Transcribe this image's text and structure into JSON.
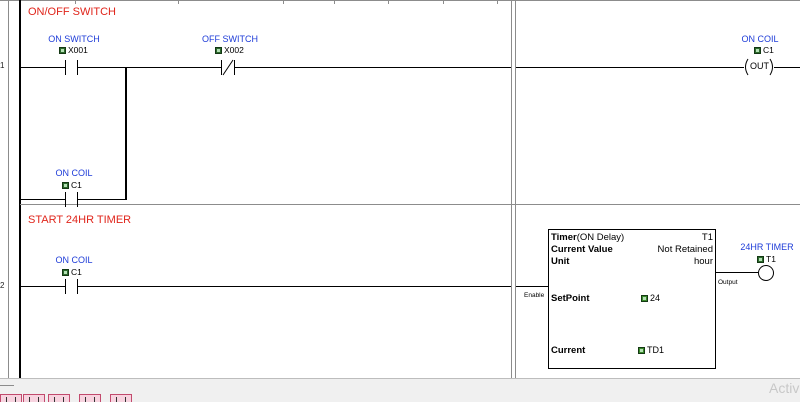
{
  "rung1": {
    "number": "1",
    "comment": "ON/OFF SWITCH",
    "on_switch": {
      "name": "ON SWITCH",
      "address": "X001"
    },
    "off_switch": {
      "name": "OFF SWITCH",
      "address": "X002"
    },
    "seal_in": {
      "name": "ON COIL",
      "address": "C1"
    },
    "coil": {
      "name": "ON COIL",
      "address": "C1",
      "instruction": "OUT"
    }
  },
  "rung2": {
    "number": "2",
    "comment": "START 24HR TIMER",
    "contact": {
      "name": "ON COIL",
      "address": "C1"
    },
    "timer": {
      "title": "Timer",
      "mode": "(ON Delay)",
      "id": "T1",
      "current_value_label": "Current Value",
      "current_value": "Not Retained",
      "unit_label": "Unit",
      "unit": "hour",
      "enable_label": "Enable",
      "setpoint_label": "SetPoint",
      "setpoint_value": "24",
      "current_label": "Current",
      "current_address": "TD1",
      "output_label": "Output"
    },
    "output": {
      "name": "24HR TIMER",
      "address": "T1"
    }
  },
  "watermark": "Activ"
}
